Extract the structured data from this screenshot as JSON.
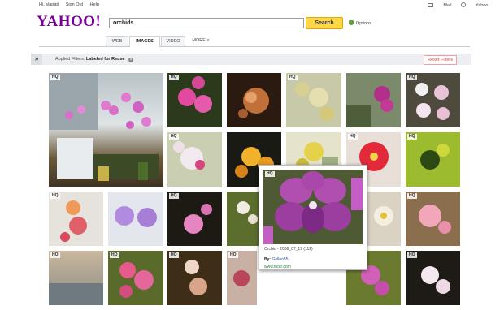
{
  "topbar": {
    "greeting": "Hi, slapati",
    "sign_out": "Sign Out",
    "help": "Help",
    "mail": "Mail",
    "yahoo_home": "Yahoo!"
  },
  "logo": "YAHOO!",
  "search": {
    "query": "orchids",
    "button": "Search",
    "options": "Options"
  },
  "tabs": [
    {
      "label": "WEB"
    },
    {
      "label": "IMAGES",
      "active": true
    },
    {
      "label": "VIDEO"
    },
    {
      "label": "MORE ˅"
    }
  ],
  "filters": {
    "collapse": "»",
    "applied_label": "Applied Filters:",
    "applied_value": "Labeled for Reuse",
    "clear": "×",
    "reset": "Reset Filters"
  },
  "hq_label": "HQ",
  "popup": {
    "title": "Orchid - 2008_07_19 (112)",
    "by_label": "By:",
    "by_author": "Gelleo55",
    "source": "www.flickr.com"
  },
  "colors": {
    "brand": "#7b0099",
    "search_button": "#ffd84a",
    "link": "#1a4a9a",
    "source": "#1d8a3a"
  }
}
